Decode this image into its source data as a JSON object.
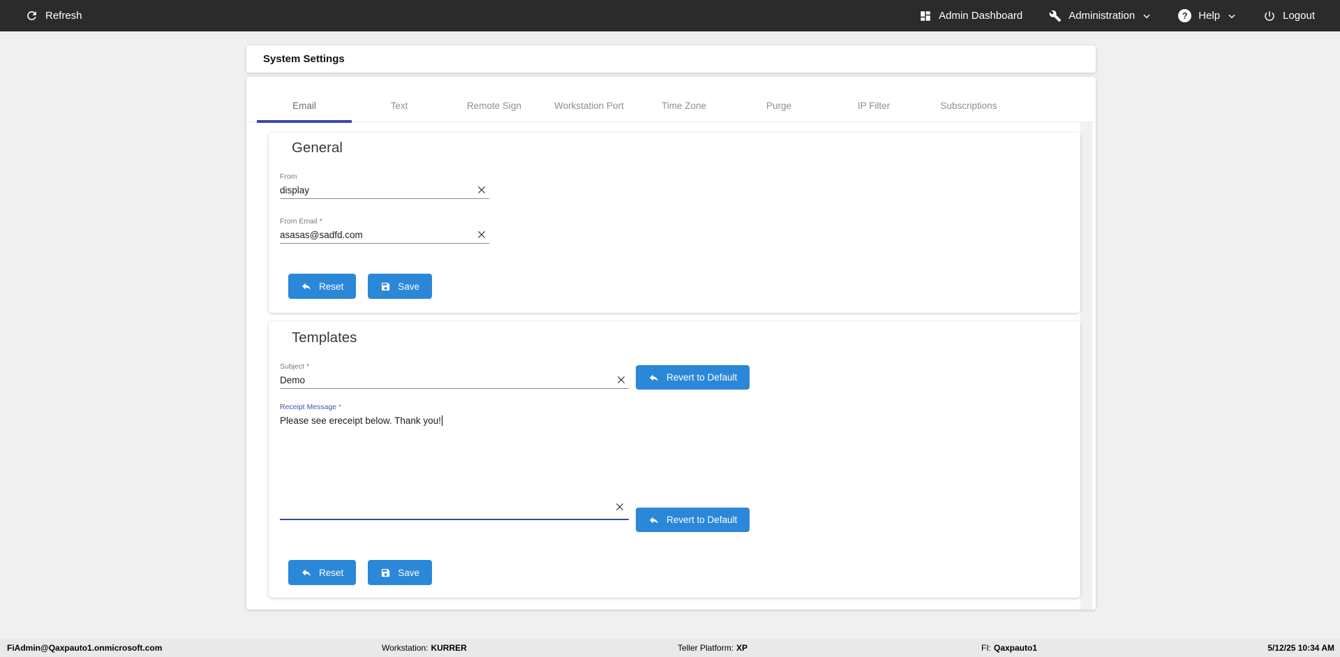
{
  "topbar": {
    "refresh": "Refresh",
    "admin_dashboard": "Admin Dashboard",
    "administration": "Administration",
    "help": "Help",
    "logout": "Logout"
  },
  "page": {
    "title": "System Settings"
  },
  "tabs": [
    {
      "label": "Email",
      "active": true
    },
    {
      "label": "Text",
      "active": false
    },
    {
      "label": "Remote Sign",
      "active": false
    },
    {
      "label": "Workstation Port",
      "active": false
    },
    {
      "label": "Time Zone",
      "active": false
    },
    {
      "label": "Purge",
      "active": false
    },
    {
      "label": "IP Filter",
      "active": false
    },
    {
      "label": "Subscriptions",
      "active": false
    }
  ],
  "general": {
    "heading": "General",
    "from_label": "From",
    "from_value": "display",
    "from_email_label": "From Email *",
    "from_email_value": "asasas@sadfd.com",
    "reset_label": "Reset",
    "save_label": "Save"
  },
  "templates": {
    "heading": "Templates",
    "subject_label": "Subject *",
    "subject_value": "Demo",
    "revert_label": "Revert to Default",
    "receipt_label": "Receipt Message",
    "receipt_required_marker": "*",
    "receipt_value": "Please see ereceipt below. Thank you!",
    "reset_label": "Reset",
    "save_label": "Save"
  },
  "statusbar": {
    "user": "FiAdmin@Qaxpauto1.onmicrosoft.com",
    "workstation_label": "Workstation:",
    "workstation_value": "KURRER",
    "teller_label": "Teller Platform:",
    "teller_value": "XP",
    "fi_label": "FI:",
    "fi_value": "Qaxpauto1",
    "datetime": "5/12/25 10:34 AM"
  },
  "colors": {
    "topbar_bg": "#2b2b2b",
    "page_bg": "#f0f0f0",
    "accent_indigo": "#3948ab",
    "button_blue": "#2b87d8",
    "statusbar_bg": "#e9e9e9",
    "required_pink": "#ef5350"
  }
}
